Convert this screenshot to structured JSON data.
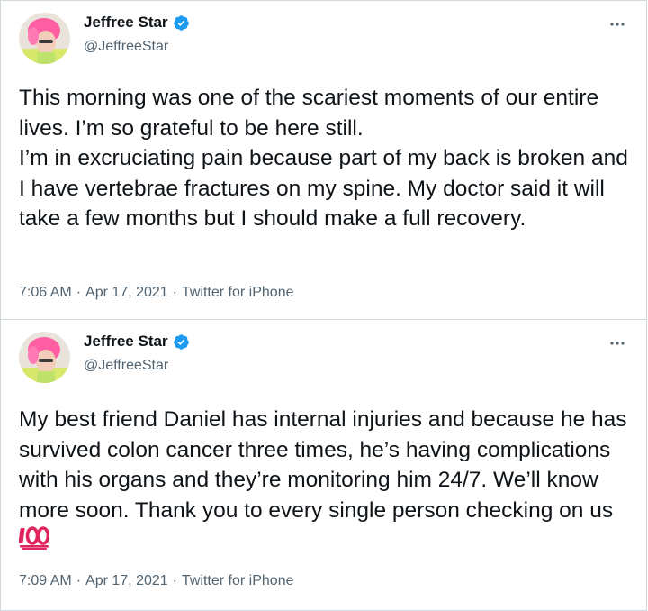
{
  "tweets": [
    {
      "display_name": "Jeffree Star",
      "handle": "@JeffreeStar",
      "text": "This morning was one of the scariest moments of our entire lives. I’m so grateful to be here still.\nI’m in excruciating pain because part of my back is broken and I have vertebrae fractures on my spine. My doctor said it will take a few months but I should make a full recovery.",
      "time": "7:06 AM",
      "date": "Apr 17, 2021",
      "source": "Twitter for iPhone"
    },
    {
      "display_name": "Jeffree Star",
      "handle": "@JeffreeStar",
      "text": "My best friend Daniel has internal injuries and because he has survived colon cancer three times, he’s having complications with his organs and they’re monitoring him 24/7. We’ll know more soon. Thank you to every single person checking on us",
      "emoji": "hundred-points-icon",
      "time": "7:09 AM",
      "date": "Apr 17, 2021",
      "source": "Twitter for iPhone"
    }
  ],
  "separator": "·",
  "colors": {
    "text": "#0f1419",
    "secondary": "#536471",
    "verified": "#1d9bf0",
    "border": "#cfd9de",
    "hair": "#ff5fa2",
    "emoji": "#e0245e"
  },
  "icons": [
    "verified-badge-icon",
    "more-options-icon",
    "hundred-points-icon"
  ]
}
